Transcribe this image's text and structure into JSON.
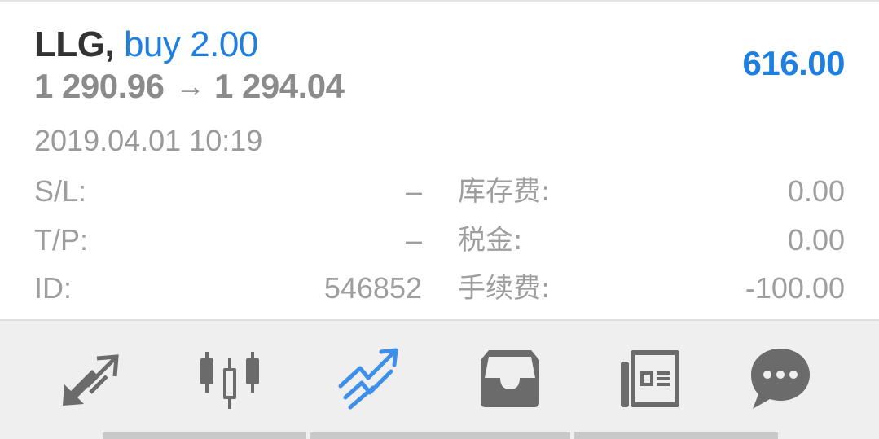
{
  "order": {
    "symbol": "LLG",
    "separator": ",",
    "side_and_volume": "buy 2.00",
    "open_price": "1 290.96",
    "arrow": "→",
    "current_price": "1 294.04",
    "profit": "616.00",
    "datetime": "2019.04.01 10:19"
  },
  "details": {
    "left": [
      {
        "label": "S/L:",
        "value": "–"
      },
      {
        "label": "T/P:",
        "value": "–"
      },
      {
        "label": "ID:",
        "value": "546852"
      }
    ],
    "right": [
      {
        "label": "库存费:",
        "value": "0.00"
      },
      {
        "label": "税金:",
        "value": "0.00"
      },
      {
        "label": "手续费:",
        "value": "-100.00"
      }
    ]
  },
  "toolbar": {
    "items": [
      {
        "icon": "quotes-arrows-icon",
        "active": false
      },
      {
        "icon": "candlestick-chart-icon",
        "active": false
      },
      {
        "icon": "trade-trend-icon",
        "active": true
      },
      {
        "icon": "inbox-icon",
        "active": false
      },
      {
        "icon": "news-icon",
        "active": false
      },
      {
        "icon": "chat-bubble-icon",
        "active": false
      }
    ],
    "active_color": "#3d8fe8",
    "inactive_color": "#6b6b6b"
  },
  "colors": {
    "accent": "#1e7fe0",
    "symbol": "#333333",
    "muted": "#9e9e9e"
  }
}
